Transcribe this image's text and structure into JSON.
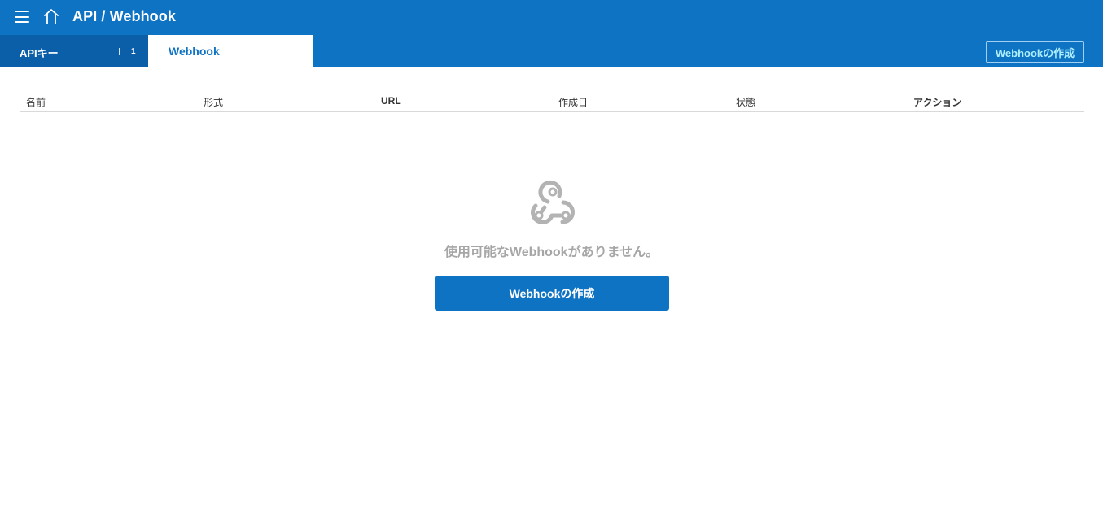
{
  "header": {
    "title": "API / Webhook",
    "menu_icon": "hamburger-menu-icon",
    "home_icon": "home-icon"
  },
  "tabs": [
    {
      "label": "APIキー",
      "count": "1",
      "active": false
    },
    {
      "label": "Webhook",
      "active": true
    }
  ],
  "toolbar": {
    "create_label": "Webhookの作成"
  },
  "table": {
    "columns": [
      "名前",
      "形式",
      "URL",
      "作成日",
      "状態",
      "アクション"
    ]
  },
  "empty_state": {
    "icon": "webhook-icon",
    "message": "使用可能なWebhookがありません。",
    "button_label": "Webhookの作成"
  },
  "colors": {
    "primary": "#0f73c4",
    "primary_dark": "#0a5fa8",
    "muted_text": "#a6a6a6",
    "accent_text": "#aef0ff"
  }
}
